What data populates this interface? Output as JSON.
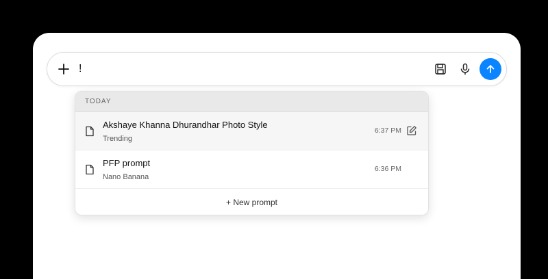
{
  "composer": {
    "input_value": "!",
    "icons": {
      "add": "plus-icon",
      "save": "save-icon",
      "mic": "mic-icon",
      "send": "arrow-up-icon"
    },
    "send_color": "#0a84ff"
  },
  "dropdown": {
    "section_label": "TODAY",
    "items": [
      {
        "title": "Akshaye Khanna Dhurandhar Photo Style",
        "subtitle": "Trending",
        "time": "6:37 PM",
        "icon": "document-icon",
        "action_icon": "edit-icon"
      },
      {
        "title": "PFP prompt",
        "subtitle": "Nano Banana",
        "time": "6:36 PM",
        "icon": "document-icon"
      }
    ],
    "new_prompt_label": "+ New prompt"
  }
}
